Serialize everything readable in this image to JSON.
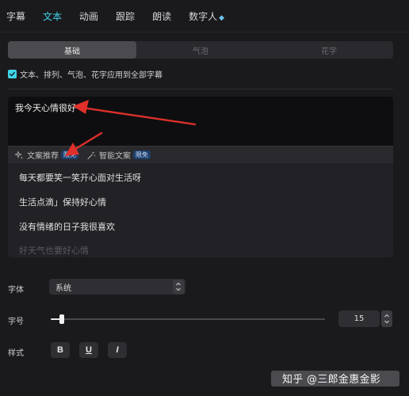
{
  "tabs": [
    {
      "label": "字幕",
      "active": false
    },
    {
      "label": "文本",
      "active": true
    },
    {
      "label": "动画",
      "active": false
    },
    {
      "label": "跟踪",
      "active": false
    },
    {
      "label": "朗读",
      "active": false
    },
    {
      "label": "数字人",
      "active": false,
      "icon": "diamond-icon"
    }
  ],
  "segments": [
    {
      "label": "基础",
      "active": true
    },
    {
      "label": "气泡",
      "active": false
    },
    {
      "label": "花字",
      "active": false
    }
  ],
  "apply_all": {
    "checked": true,
    "label": "文本、排列、气泡、花字应用到全部字幕"
  },
  "text_input": {
    "value": "我今天心情很好"
  },
  "suggest_bar": {
    "recommend_label": "文案推荐",
    "recommend_badge": "限免",
    "smart_label": "智能文案",
    "smart_badge": "限免"
  },
  "suggestions": [
    "每天都要笑一笑开心面对生活呀",
    "生活点滴」保持好心情",
    "没有情绪的日子我很喜欢",
    "好天气也要好心情"
  ],
  "font": {
    "label": "字体",
    "value": "系统"
  },
  "size": {
    "label": "字号",
    "value": "15",
    "fill": 0.04
  },
  "style": {
    "label": "样式",
    "bold": "B",
    "underline": "U",
    "italic": "I"
  },
  "watermark": "知乎 @三郎金惠金影",
  "colors": {
    "accent": "#3fd4e6",
    "annotation_arrow": "#e0302a"
  }
}
